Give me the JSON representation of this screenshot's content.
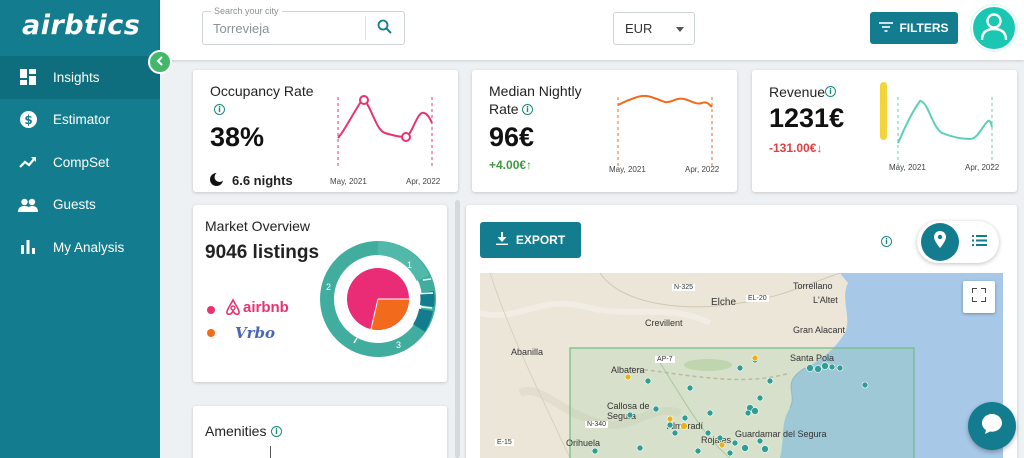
{
  "app": {
    "logo_text": "airbtics"
  },
  "sidebar": {
    "items": [
      {
        "label": "Insights",
        "icon": "dashboard-icon"
      },
      {
        "label": "Estimator",
        "icon": "dollar-icon"
      },
      {
        "label": "CompSet",
        "icon": "trending-up-icon"
      },
      {
        "label": "Guests",
        "icon": "people-icon"
      },
      {
        "label": "My Analysis",
        "icon": "bar-chart-icon"
      }
    ],
    "active_index": 0
  },
  "header": {
    "search_label": "Search your city",
    "search_value": "Torrevieja",
    "currency": "EUR",
    "filters_label": "FILTERS"
  },
  "occupancy": {
    "title": "Occupancy Rate",
    "value": "38%",
    "nights": "6.6 nights",
    "axis_start": "May, 2021",
    "axis_end": "Apr, 2022",
    "color": "#e8336f"
  },
  "nightly_rate": {
    "title_line1": "Median Nightly",
    "title_line2": "Rate",
    "value": "96€",
    "delta": "+4.00€↑",
    "axis_start": "May, 2021",
    "axis_end": "Apr, 2022",
    "color": "#f26a1b"
  },
  "revenue": {
    "title": "Revenue",
    "value": "1231€",
    "delta": "-131.00€↓",
    "axis_start": "May, 2021",
    "axis_end": "Apr, 2022",
    "color": "#5cd0b6"
  },
  "market": {
    "title": "Market Overview",
    "listings": "9046 listings",
    "brands": [
      "airbnb",
      "Vrbo"
    ],
    "brand_colors": [
      "#e8336f",
      "#f26a1b"
    ],
    "ring_labels": [
      "1",
      "2",
      "3"
    ]
  },
  "amenities": {
    "title": "Amenities"
  },
  "map_panel": {
    "export_label": "EXPORT",
    "places": [
      "Torrellano",
      "Elche",
      "L'Altet",
      "Crevillent",
      "Gran Alacant",
      "Abanilla",
      "Santa Pola",
      "Albatera",
      "Callosa de Segura",
      "Almoradí",
      "Orihuela",
      "Rojales",
      "Guardamar del Segura"
    ],
    "roads": [
      "N-325",
      "EL-20",
      "AP-7",
      "N-340",
      "E-15"
    ]
  }
}
